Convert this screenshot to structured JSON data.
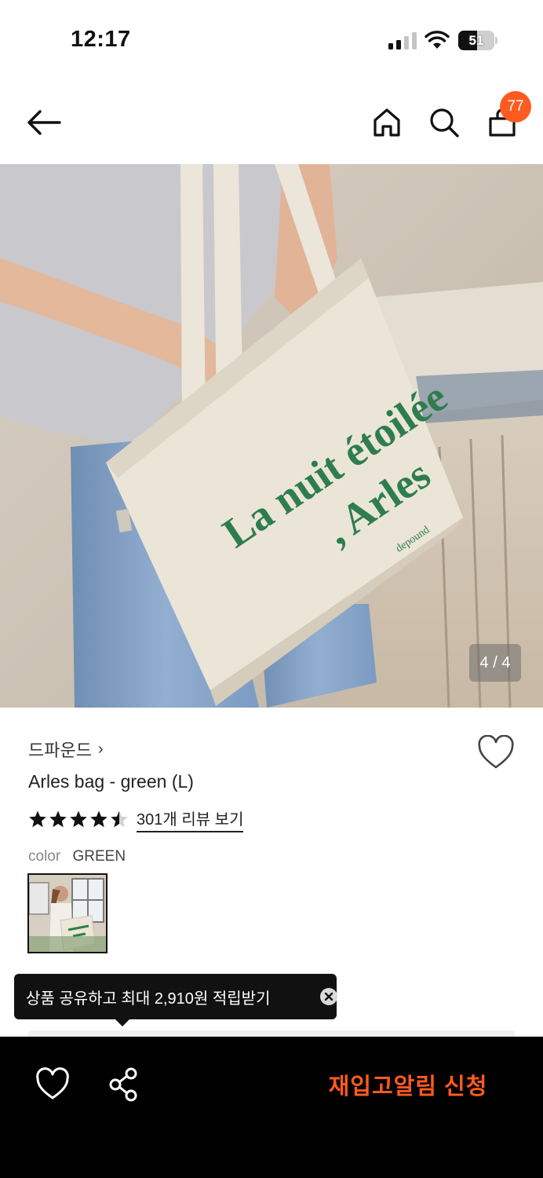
{
  "status_bar": {
    "time": "12:17",
    "battery": "51"
  },
  "nav": {
    "cart_count": "77"
  },
  "gallery": {
    "counter": "4 / 4",
    "bag_print_line1": "La nuit étoilée",
    "bag_print_line2": ", Arles",
    "bag_brand": "depound"
  },
  "product": {
    "brand": "드파운드",
    "name": "Arles bag - green (L)",
    "rating": 4.5,
    "review_link": "301개 리뷰 보기",
    "option_label": "color",
    "option_value": "GREEN"
  },
  "tooltip": {
    "text": "상품 공유하고 최대 2,910원 적립받기"
  },
  "bottom_bar": {
    "restock_label": "재입고알림 신청"
  },
  "colors": {
    "accent": "#ff5a1f",
    "bag_print": "#2e7d4f",
    "bar_bg": "#000000"
  },
  "icons": [
    "back-arrow-icon",
    "home-icon",
    "search-icon",
    "cart-icon",
    "heart-icon",
    "star-icon",
    "close-icon",
    "share-icon"
  ]
}
